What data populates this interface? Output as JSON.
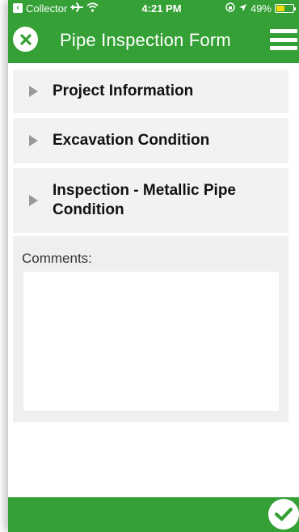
{
  "status_bar": {
    "back_app": "Collector",
    "time": "4:21 PM",
    "battery_percent": "49%",
    "battery_level": 0.49,
    "icons": [
      "back-chevron-icon",
      "airplane-icon",
      "wifi-icon",
      "orientation-lock-icon",
      "location-arrow-icon",
      "battery-icon"
    ]
  },
  "header": {
    "title": "Pipe Inspection Form",
    "close_icon": "close-icon",
    "menu_icon": "hamburger-menu-icon"
  },
  "sections": [
    {
      "label": "Project Information",
      "expanded": false
    },
    {
      "label": "Excavation Condition",
      "expanded": false
    },
    {
      "label": "Inspection - Metallic Pipe Condition",
      "expanded": false
    }
  ],
  "comments": {
    "label": "Comments:",
    "value": ""
  },
  "footer": {
    "submit_icon": "checkmark-icon"
  },
  "colors": {
    "brand_green": "#35a036",
    "section_bg": "#f2f2f2",
    "arrow_gray": "#9a9a9a",
    "battery_yellow": "#f5d90a"
  }
}
